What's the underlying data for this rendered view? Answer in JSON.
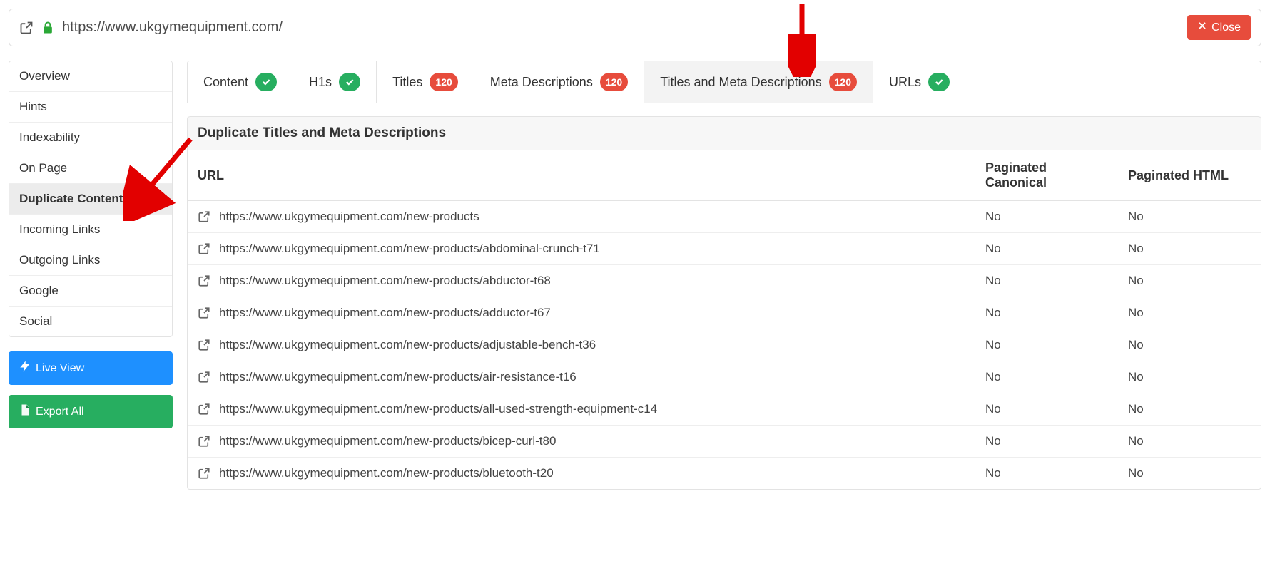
{
  "urlbar": {
    "url": "https://www.ukgymequipment.com/"
  },
  "close_button": "Close",
  "sidebar": {
    "items": [
      {
        "label": "Overview",
        "active": false
      },
      {
        "label": "Hints",
        "active": false
      },
      {
        "label": "Indexability",
        "active": false
      },
      {
        "label": "On Page",
        "active": false
      },
      {
        "label": "Duplicate Content",
        "active": true
      },
      {
        "label": "Incoming Links",
        "active": false
      },
      {
        "label": "Outgoing Links",
        "active": false
      },
      {
        "label": "Google",
        "active": false
      },
      {
        "label": "Social",
        "active": false
      }
    ],
    "live_view": "Live View",
    "export_all": "Export All"
  },
  "tabs": [
    {
      "label": "Content",
      "badge_type": "check",
      "active": false
    },
    {
      "label": "H1s",
      "badge_type": "check",
      "active": false
    },
    {
      "label": "Titles",
      "badge_type": "count",
      "count": "120",
      "active": false
    },
    {
      "label": "Meta Descriptions",
      "badge_type": "count",
      "count": "120",
      "active": false
    },
    {
      "label": "Titles and Meta Descriptions",
      "badge_type": "count",
      "count": "120",
      "active": true
    },
    {
      "label": "URLs",
      "badge_type": "check",
      "active": false
    }
  ],
  "panel": {
    "title": "Duplicate Titles and Meta Descriptions",
    "columns": [
      "URL",
      "Paginated Canonical",
      "Paginated HTML"
    ],
    "rows": [
      {
        "url": "https://www.ukgymequipment.com/new-products",
        "pc": "No",
        "ph": "No"
      },
      {
        "url": "https://www.ukgymequipment.com/new-products/abdominal-crunch-t71",
        "pc": "No",
        "ph": "No"
      },
      {
        "url": "https://www.ukgymequipment.com/new-products/abductor-t68",
        "pc": "No",
        "ph": "No"
      },
      {
        "url": "https://www.ukgymequipment.com/new-products/adductor-t67",
        "pc": "No",
        "ph": "No"
      },
      {
        "url": "https://www.ukgymequipment.com/new-products/adjustable-bench-t36",
        "pc": "No",
        "ph": "No"
      },
      {
        "url": "https://www.ukgymequipment.com/new-products/air-resistance-t16",
        "pc": "No",
        "ph": "No"
      },
      {
        "url": "https://www.ukgymequipment.com/new-products/all-used-strength-equipment-c14",
        "pc": "No",
        "ph": "No"
      },
      {
        "url": "https://www.ukgymequipment.com/new-products/bicep-curl-t80",
        "pc": "No",
        "ph": "No"
      },
      {
        "url": "https://www.ukgymequipment.com/new-products/bluetooth-t20",
        "pc": "No",
        "ph": "No"
      }
    ]
  }
}
